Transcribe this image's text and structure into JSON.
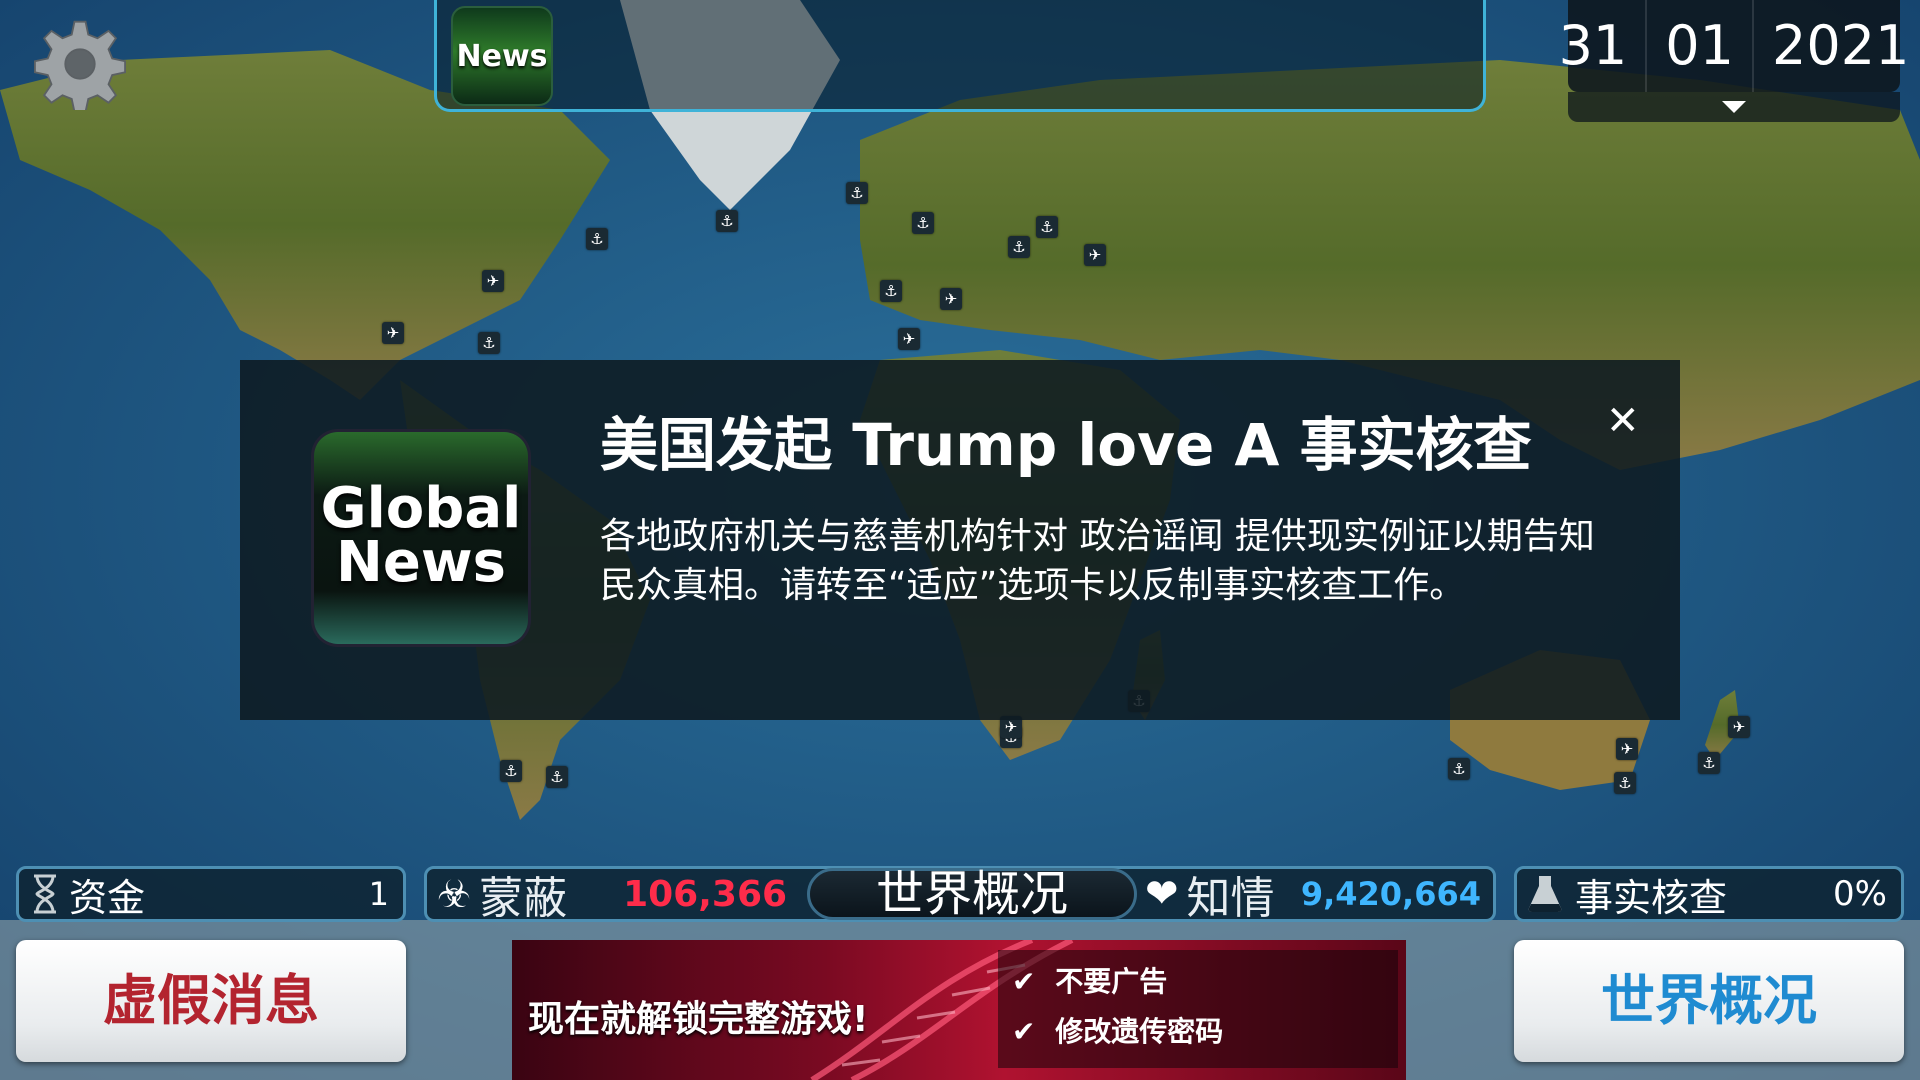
{
  "top": {
    "news_label": "News",
    "date": {
      "day": "31",
      "month": "01",
      "year": "2021"
    }
  },
  "popup": {
    "logo_line1": "Global",
    "logo_line2": "News",
    "title": "美国发起 Trump love A 事实核查",
    "body": "各地政府机关与慈善机构针对 政治谣闻 提供现实例证以期告知民众真相。请转至“适应”选项卡以反制事实核查工作。",
    "close": "✕"
  },
  "stats": {
    "funds_label": "资金",
    "funds_value": "1",
    "stealth_label": "蒙蔽",
    "stealth_value": "106,366",
    "world_tab": "世界概况",
    "aware_label": "知情",
    "aware_value": "9,420,664",
    "factcheck_label": "事实核查",
    "factcheck_value": "0%"
  },
  "buttons": {
    "fake_news": "虚假消息",
    "world": "世界概况"
  },
  "ad": {
    "main": "现在就解锁完整游戏!",
    "line1": "不要广告",
    "line2": "修改遗传密码",
    "check": "✔"
  },
  "colors": {
    "ocean": "#1c4f78",
    "land": "#4f6a2c",
    "accent_border": "#3fb3d8",
    "stealth_value": "#ff2c4a",
    "aware_value": "#3fb6ff",
    "fake_news_button_text": "#b3242f",
    "world_button_text": "#1f8bd1"
  },
  "icons": [
    "gear-icon",
    "anchor-icon",
    "airplane-icon",
    "biohazard-icon",
    "heart-icon",
    "flask-icon",
    "hourglass-icon",
    "close-icon",
    "check-icon"
  ]
}
